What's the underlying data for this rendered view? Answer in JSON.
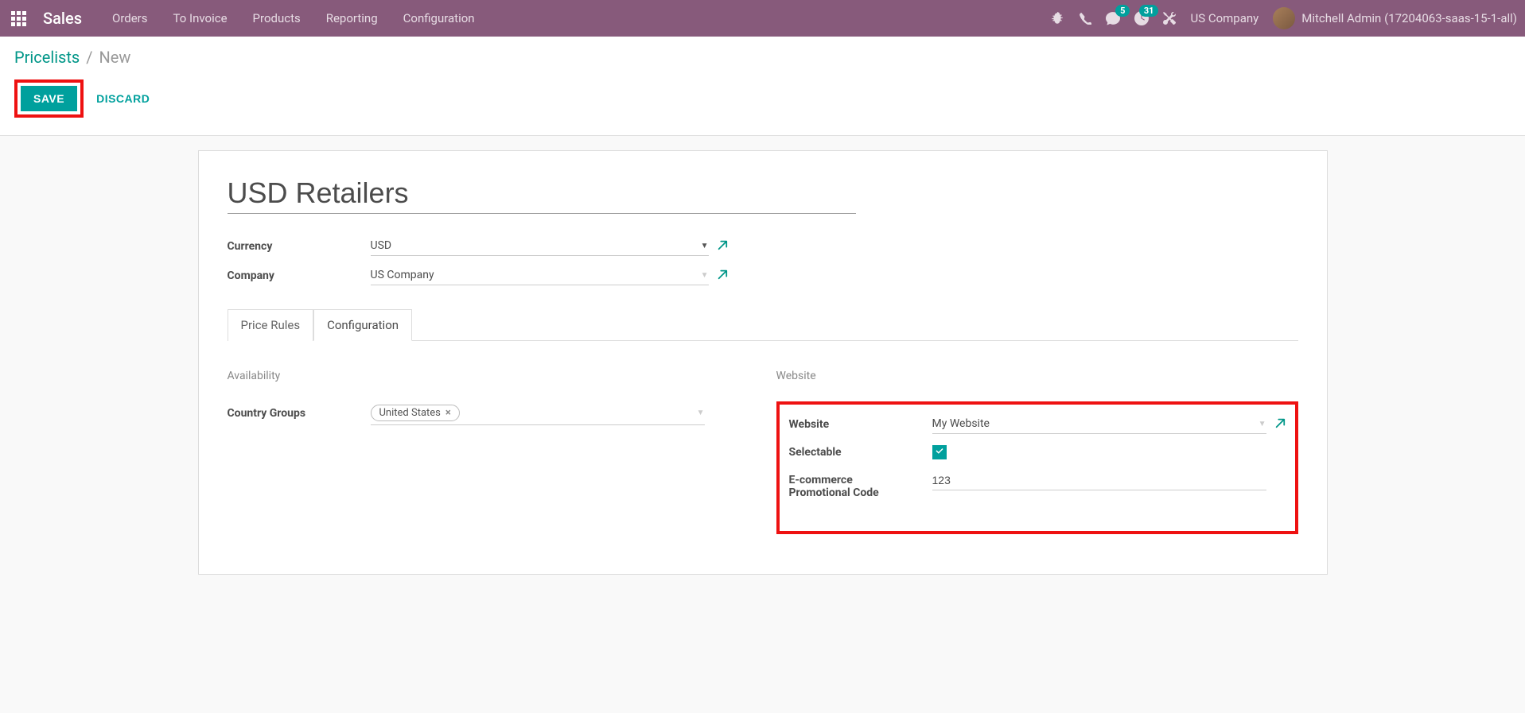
{
  "navbar": {
    "brand": "Sales",
    "menu": [
      "Orders",
      "To Invoice",
      "Products",
      "Reporting",
      "Configuration"
    ],
    "msg_count": "5",
    "activity_count": "31",
    "company": "US Company",
    "user": "Mitchell Admin (17204063-saas-15-1-all)"
  },
  "breadcrumb": {
    "link": "Pricelists",
    "sep": "/",
    "active": "New"
  },
  "buttons": {
    "save": "Save",
    "discard": "Discard"
  },
  "form": {
    "title": "USD Retailers",
    "currency_label": "Currency",
    "currency_value": "USD",
    "company_label": "Company",
    "company_value": "US Company"
  },
  "tabs": {
    "price_rules": "Price Rules",
    "configuration": "Configuration"
  },
  "availability": {
    "section": "Availability",
    "country_groups_label": "Country Groups",
    "country_tag": "United States"
  },
  "website": {
    "section": "Website",
    "website_label": "Website",
    "website_value": "My Website",
    "selectable_label": "Selectable",
    "ecom_label_line1": "E-commerce",
    "ecom_label_line2": "Promotional Code",
    "ecom_code": "123"
  }
}
